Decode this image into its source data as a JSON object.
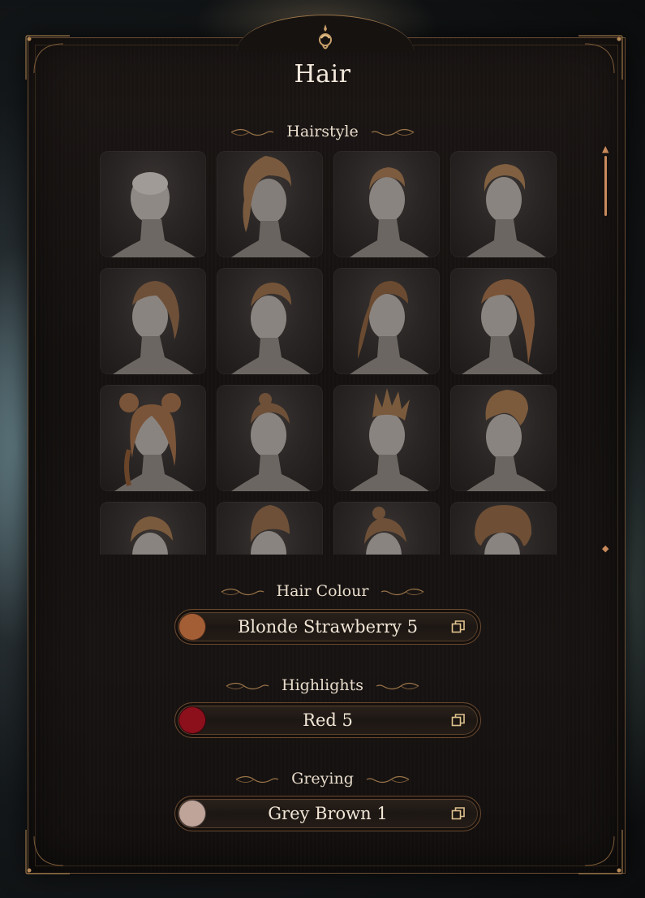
{
  "panel": {
    "title": "Hair"
  },
  "hairstyle": {
    "label": "Hairstyle"
  },
  "hair_colour": {
    "label": "Hair Colour",
    "value": "Blonde Strawberry 5",
    "swatch": "#a35e36"
  },
  "highlights": {
    "label": "Highlights",
    "value": "Red 5",
    "swatch": "#8c0f1c"
  },
  "greying": {
    "label": "Greying",
    "value": "Grey Brown 1",
    "swatch": "#bfa49a"
  },
  "colors": {
    "accent": "#c98a5c",
    "frame": "#8a6440",
    "text": "#f1e6d6"
  }
}
